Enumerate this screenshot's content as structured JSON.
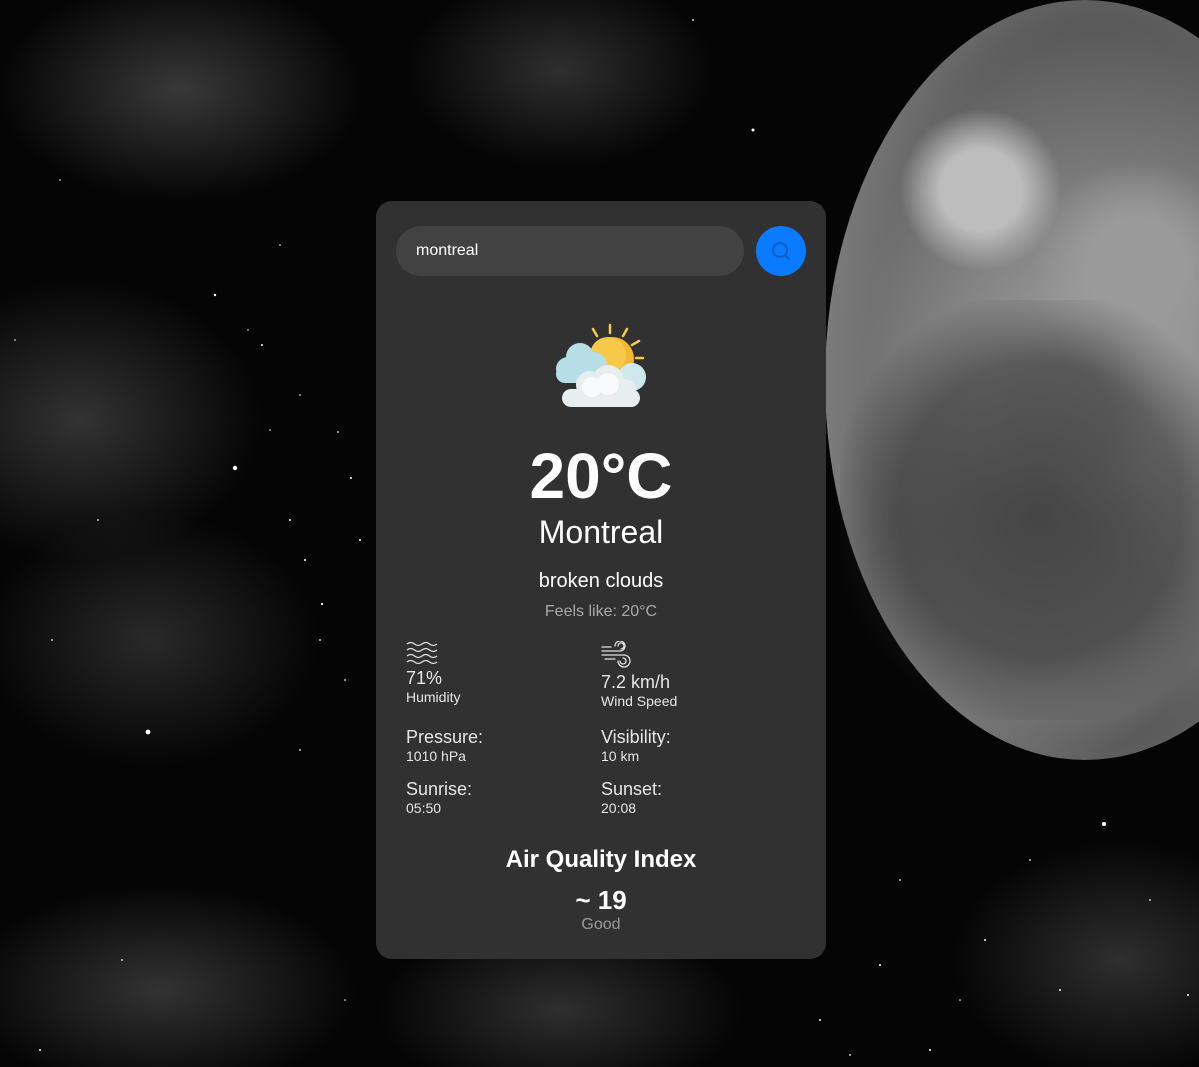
{
  "search": {
    "value": "montreal",
    "button_icon": "search-icon"
  },
  "weather": {
    "icon": "partly-cloudy-sun-icon",
    "temperature": "20°C",
    "city": "Montreal",
    "description": "broken clouds",
    "feels_like": "Feels like: 20°C"
  },
  "details": {
    "humidity": {
      "icon": "humidity-waves-icon",
      "value": "71%",
      "label": "Humidity"
    },
    "wind": {
      "icon": "wind-icon",
      "value": "7.2 km/h",
      "label": "Wind Speed"
    },
    "pressure": {
      "label": "Pressure:",
      "value": "1010 hPa"
    },
    "visibility": {
      "label": "Visibility:",
      "value": "10 km"
    },
    "sunrise": {
      "label": "Sunrise:",
      "value": "05:50"
    },
    "sunset": {
      "label": "Sunset:",
      "value": "20:08"
    }
  },
  "aqi": {
    "title": "Air Quality Index",
    "value": "~ 19",
    "label": "Good"
  },
  "colors": {
    "card_bg": "#313131",
    "input_bg": "#424242",
    "accent": "#0a7bff",
    "muted_text": "#9a9a9a"
  }
}
